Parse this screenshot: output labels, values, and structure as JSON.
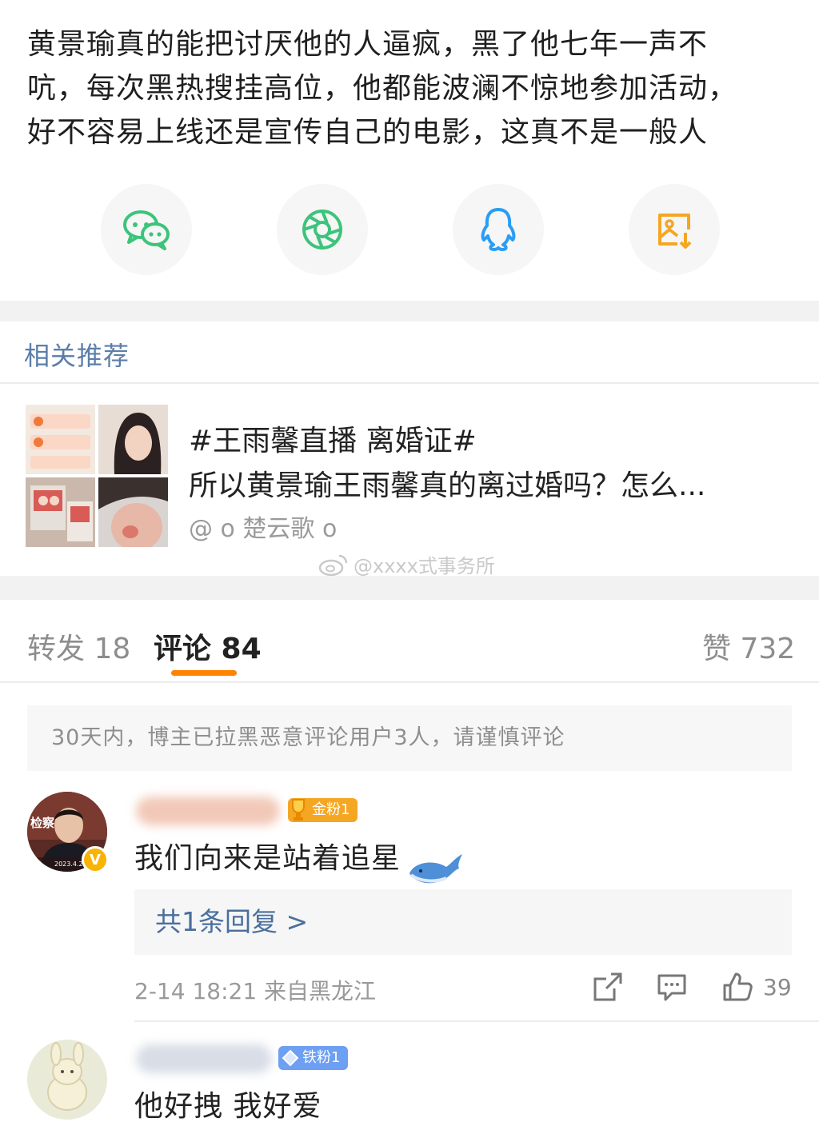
{
  "post": {
    "line1": "黄景瑜真的能把讨厌他的人逼疯，黑了他七年一声不",
    "line2": "吭，每次黑热搜挂高位，他都能波澜不惊地参加活动，",
    "line3": "好不容易上线还是宣传自己的电影，这真不是一般人"
  },
  "share": {
    "items": [
      {
        "icon": "wechat-icon",
        "color": "#3cc47a"
      },
      {
        "icon": "moments-icon",
        "color": "#3cc47a"
      },
      {
        "icon": "qq-icon",
        "color": "#2a9df4"
      },
      {
        "icon": "save-image-icon",
        "color": "#f5a623"
      }
    ]
  },
  "recommend": {
    "section_title": "相关推荐",
    "item": {
      "title": "#王雨馨直播 离婚证#",
      "subtitle": "所以黄景瑜王雨馨真的离过婚吗？怎么...",
      "author": "@ o 楚云歌 o"
    }
  },
  "watermark": "@xxxx式事务所",
  "tabs": {
    "repost": "转发 18",
    "comments": "评论 84",
    "likes": "赞 732"
  },
  "notice": "30天内，博主已拉黑恶意评论用户3人，请谨慎评论",
  "comments": [
    {
      "badge": "金粉1",
      "badge_color": "#f5a623",
      "avatar_text": "检察",
      "avatar_date": "2023.4.29",
      "text": "我们向来是站着追星",
      "reply_link": "共1条回复 >",
      "time_location": "2-14 18:21 来自黑龙江",
      "like_count": "39"
    },
    {
      "badge": "铁粉1",
      "badge_color": "#6d9ff2",
      "text": "他好拽 我好爱"
    }
  ],
  "colors": {
    "accent": "#ff8200",
    "link": "#4a6f9c",
    "section_title": "#5b7ea8"
  }
}
